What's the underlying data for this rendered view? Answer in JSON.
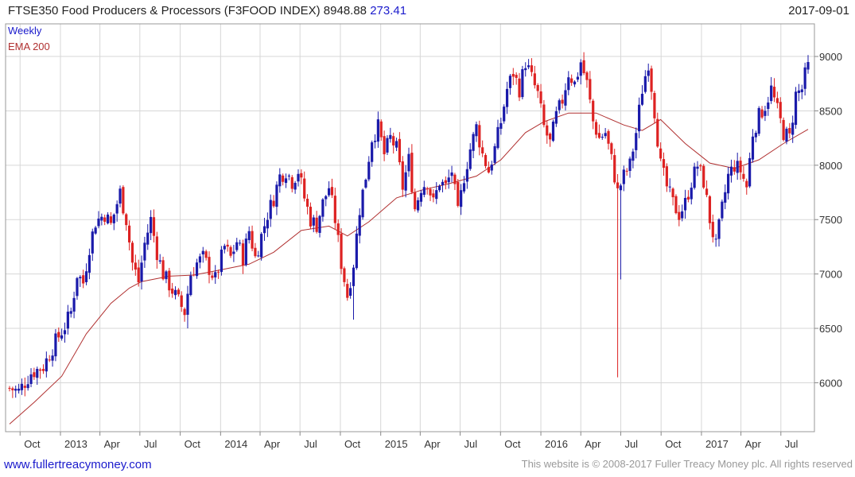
{
  "header": {
    "title": "FTSE350 Food Producers & Processors (F3FOOD INDEX)",
    "last_value": "8948.88",
    "change": "273.41",
    "date": "2017-09-01"
  },
  "legend": {
    "period": "Weekly",
    "ema": "EMA 200"
  },
  "footer": {
    "website": "www.fullertreacymoney.com",
    "copyright": "This website is © 2008-2017 Fuller Treacy Money plc. All rights reserved"
  },
  "colors": {
    "up": "#1a1aaa",
    "down": "#dd2222",
    "ema": "#b03030",
    "grid": "#d7d7d7",
    "link": "#1a1acc",
    "change": "#1a1acc"
  },
  "chart_data": {
    "type": "candlestick",
    "frequency": "weekly",
    "title": "FTSE350 Food Producers & Processors (F3FOOD INDEX)",
    "ylim": [
      5550,
      9300
    ],
    "y_ticks": [
      6000,
      6500,
      7000,
      7500,
      8000,
      8500,
      9000
    ],
    "x_ticks": [
      {
        "label": "Oct",
        "date": "2012-10-01"
      },
      {
        "label": "2013",
        "date": "2013-01-01"
      },
      {
        "label": "Apr",
        "date": "2013-04-01"
      },
      {
        "label": "Jul",
        "date": "2013-07-01"
      },
      {
        "label": "Oct",
        "date": "2013-10-01"
      },
      {
        "label": "2014",
        "date": "2014-01-01"
      },
      {
        "label": "Apr",
        "date": "2014-04-01"
      },
      {
        "label": "Jul",
        "date": "2014-07-01"
      },
      {
        "label": "Oct",
        "date": "2014-10-01"
      },
      {
        "label": "2015",
        "date": "2015-01-01"
      },
      {
        "label": "Apr",
        "date": "2015-04-01"
      },
      {
        "label": "Jul",
        "date": "2015-07-01"
      },
      {
        "label": "Oct",
        "date": "2015-10-01"
      },
      {
        "label": "2016",
        "date": "2016-01-01"
      },
      {
        "label": "Apr",
        "date": "2016-04-01"
      },
      {
        "label": "Jul",
        "date": "2016-07-01"
      },
      {
        "label": "Oct",
        "date": "2016-10-01"
      },
      {
        "label": "2017",
        "date": "2017-01-01"
      },
      {
        "label": "Apr",
        "date": "2017-04-01"
      },
      {
        "label": "Jul",
        "date": "2017-07-01"
      }
    ],
    "close_path": [
      [
        "2012-09-07",
        5950
      ],
      [
        "2012-09-28",
        5920
      ],
      [
        "2012-10-26",
        6090
      ],
      [
        "2012-11-23",
        6150
      ],
      [
        "2012-12-21",
        6380
      ],
      [
        "2013-01-11",
        6520
      ],
      [
        "2013-01-25",
        6650
      ],
      [
        "2013-02-08",
        7000
      ],
      [
        "2013-02-22",
        6920
      ],
      [
        "2013-03-08",
        7250
      ],
      [
        "2013-03-22",
        7480
      ],
      [
        "2013-04-12",
        7550
      ],
      [
        "2013-04-26",
        7450
      ],
      [
        "2013-05-17",
        7750
      ],
      [
        "2013-05-31",
        7500
      ],
      [
        "2013-06-14",
        7100
      ],
      [
        "2013-06-28",
        6930
      ],
      [
        "2013-07-12",
        7280
      ],
      [
        "2013-07-26",
        7500
      ],
      [
        "2013-08-09",
        7200
      ],
      [
        "2013-08-23",
        7000
      ],
      [
        "2013-09-13",
        6850
      ],
      [
        "2013-09-27",
        6750
      ],
      [
        "2013-10-11",
        6650
      ],
      [
        "2013-10-25",
        7000
      ],
      [
        "2013-11-08",
        7100
      ],
      [
        "2013-11-22",
        7150
      ],
      [
        "2013-12-06",
        7050
      ],
      [
        "2013-12-20",
        6950
      ],
      [
        "2014-01-10",
        7250
      ],
      [
        "2014-01-24",
        7150
      ],
      [
        "2014-02-07",
        7300
      ],
      [
        "2014-02-21",
        7150
      ],
      [
        "2014-03-07",
        7400
      ],
      [
        "2014-03-21",
        7150
      ],
      [
        "2014-04-04",
        7350
      ],
      [
        "2014-04-18",
        7550
      ],
      [
        "2014-05-02",
        7700
      ],
      [
        "2014-05-16",
        7900
      ],
      [
        "2014-05-30",
        7950
      ],
      [
        "2014-06-13",
        7850
      ],
      [
        "2014-06-27",
        7950
      ],
      [
        "2014-07-11",
        7700
      ],
      [
        "2014-07-25",
        7500
      ],
      [
        "2014-08-08",
        7450
      ],
      [
        "2014-08-22",
        7650
      ],
      [
        "2014-09-05",
        7800
      ],
      [
        "2014-09-19",
        7500
      ],
      [
        "2014-10-03",
        7100
      ],
      [
        "2014-10-17",
        6800
      ],
      [
        "2014-10-31",
        7100
      ],
      [
        "2014-11-14",
        7600
      ],
      [
        "2014-11-28",
        7900
      ],
      [
        "2014-12-12",
        8250
      ],
      [
        "2014-12-26",
        8350
      ],
      [
        "2015-01-09",
        8100
      ],
      [
        "2015-01-23",
        8250
      ],
      [
        "2015-02-06",
        8150
      ],
      [
        "2015-02-20",
        7800
      ],
      [
        "2015-03-06",
        8050
      ],
      [
        "2015-03-20",
        7600
      ],
      [
        "2015-04-03",
        7800
      ],
      [
        "2015-04-17",
        7850
      ],
      [
        "2015-05-01",
        7650
      ],
      [
        "2015-05-15",
        7850
      ],
      [
        "2015-05-29",
        7800
      ],
      [
        "2015-06-12",
        7950
      ],
      [
        "2015-06-26",
        7550
      ],
      [
        "2015-07-10",
        7900
      ],
      [
        "2015-07-24",
        8150
      ],
      [
        "2015-08-07",
        8350
      ],
      [
        "2015-08-21",
        8100
      ],
      [
        "2015-09-04",
        7950
      ],
      [
        "2015-09-18",
        8150
      ],
      [
        "2015-10-02",
        8400
      ],
      [
        "2015-10-16",
        8700
      ],
      [
        "2015-10-30",
        8850
      ],
      [
        "2015-11-13",
        8700
      ],
      [
        "2015-11-27",
        8950
      ],
      [
        "2015-12-11",
        8800
      ],
      [
        "2015-12-25",
        8650
      ],
      [
        "2016-01-08",
        8350
      ],
      [
        "2016-01-22",
        8200
      ],
      [
        "2016-02-05",
        8450
      ],
      [
        "2016-02-19",
        8600
      ],
      [
        "2016-03-04",
        8850
      ],
      [
        "2016-03-18",
        8750
      ],
      [
        "2016-04-01",
        8950
      ],
      [
        "2016-04-15",
        8750
      ],
      [
        "2016-04-29",
        8400
      ],
      [
        "2016-05-13",
        8250
      ],
      [
        "2016-05-27",
        8300
      ],
      [
        "2016-06-10",
        8050
      ],
      [
        "2016-06-24",
        7750
      ],
      [
        "2016-07-08",
        7900
      ],
      [
        "2016-07-22",
        8000
      ],
      [
        "2016-08-05",
        8300
      ],
      [
        "2016-08-19",
        8700
      ],
      [
        "2016-09-02",
        8950
      ],
      [
        "2016-09-16",
        8500
      ],
      [
        "2016-09-30",
        8000
      ],
      [
        "2016-10-14",
        7800
      ],
      [
        "2016-10-28",
        7650
      ],
      [
        "2016-11-11",
        7550
      ],
      [
        "2016-11-25",
        7650
      ],
      [
        "2016-12-09",
        7850
      ],
      [
        "2016-12-23",
        8000
      ],
      [
        "2017-01-06",
        7850
      ],
      [
        "2017-01-20",
        7500
      ],
      [
        "2017-02-03",
        7250
      ],
      [
        "2017-02-17",
        7600
      ],
      [
        "2017-03-03",
        7900
      ],
      [
        "2017-03-17",
        8000
      ],
      [
        "2017-03-31",
        7950
      ],
      [
        "2017-04-14",
        7800
      ],
      [
        "2017-04-28",
        8300
      ],
      [
        "2017-05-12",
        8450
      ],
      [
        "2017-05-26",
        8550
      ],
      [
        "2017-06-09",
        8700
      ],
      [
        "2017-06-23",
        8500
      ],
      [
        "2017-07-07",
        8300
      ],
      [
        "2017-07-21",
        8250
      ],
      [
        "2017-08-04",
        8650
      ],
      [
        "2017-08-18",
        8700
      ],
      [
        "2017-09-01",
        8949
      ]
    ],
    "spikes": [
      {
        "date": "2016-06-24",
        "low": 6050
      },
      {
        "date": "2016-07-01",
        "low": 6950
      },
      {
        "date": "2014-10-31",
        "low": 6580
      },
      {
        "date": "2013-10-18",
        "low": 6500
      }
    ],
    "ema200": [
      [
        "2012-09-07",
        5620
      ],
      [
        "2012-11-02",
        5820
      ],
      [
        "2013-01-04",
        6060
      ],
      [
        "2013-03-01",
        6450
      ],
      [
        "2013-04-26",
        6730
      ],
      [
        "2013-06-07",
        6870
      ],
      [
        "2013-07-05",
        6930
      ],
      [
        "2013-09-06",
        6980
      ],
      [
        "2013-11-01",
        6990
      ],
      [
        "2014-01-03",
        7040
      ],
      [
        "2014-03-07",
        7090
      ],
      [
        "2014-05-02",
        7200
      ],
      [
        "2014-07-04",
        7400
      ],
      [
        "2014-09-05",
        7440
      ],
      [
        "2014-10-17",
        7350
      ],
      [
        "2014-12-05",
        7480
      ],
      [
        "2015-02-06",
        7700
      ],
      [
        "2015-04-03",
        7770
      ],
      [
        "2015-06-05",
        7830
      ],
      [
        "2015-08-07",
        7900
      ],
      [
        "2015-10-02",
        8050
      ],
      [
        "2015-11-27",
        8300
      ],
      [
        "2016-01-08",
        8400
      ],
      [
        "2016-03-04",
        8480
      ],
      [
        "2016-05-06",
        8480
      ],
      [
        "2016-07-08",
        8370
      ],
      [
        "2016-08-19",
        8320
      ],
      [
        "2016-09-30",
        8420
      ],
      [
        "2016-11-25",
        8200
      ],
      [
        "2017-01-20",
        8020
      ],
      [
        "2017-03-17",
        7970
      ],
      [
        "2017-05-12",
        8050
      ],
      [
        "2017-07-07",
        8200
      ],
      [
        "2017-09-01",
        8330
      ]
    ],
    "data_end": "2017-09-01",
    "latest_close": 8948.88,
    "latest_change": 273.41,
    "grid": true,
    "y_axis_side": "right"
  }
}
